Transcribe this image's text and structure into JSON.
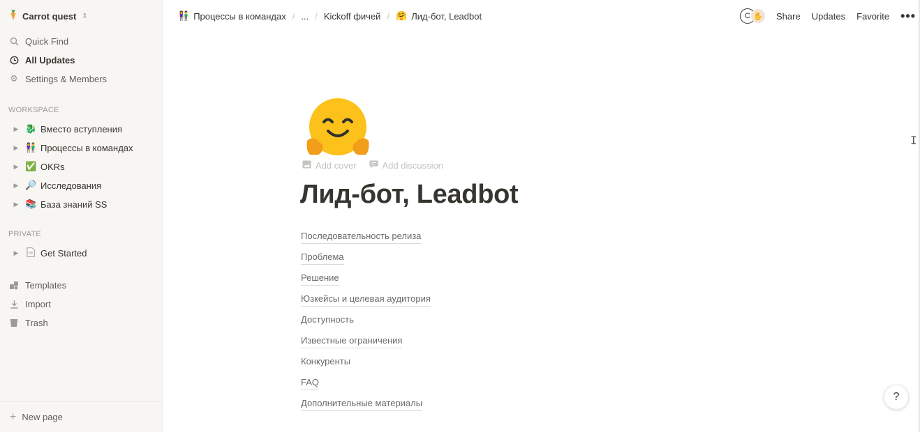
{
  "workspace": {
    "name": "Carrot quest",
    "icon": "carrot-icon"
  },
  "sidebar": {
    "top_items": [
      {
        "label": "Quick Find",
        "icon": "search-icon"
      },
      {
        "label": "All Updates",
        "icon": "clock-icon"
      },
      {
        "label": "Settings & Members",
        "icon": "gear-icon"
      }
    ],
    "workspace_label": "WORKSPACE",
    "workspace_pages": [
      {
        "emoji": "🐉",
        "label": "Вместо вступления"
      },
      {
        "emoji": "👫",
        "label": "Процессы в командах"
      },
      {
        "emoji": "✅",
        "label": "OKRs"
      },
      {
        "emoji": "🔎",
        "label": "Исследования"
      },
      {
        "emoji": "📚",
        "label": "База знаний SS"
      }
    ],
    "private_label": "PRIVATE",
    "private_pages": [
      {
        "emoji": "📄",
        "label": "Get Started"
      }
    ],
    "bottom_items": [
      {
        "label": "Templates",
        "icon": "templates-icon"
      },
      {
        "label": "Import",
        "icon": "import-icon"
      },
      {
        "label": "Trash",
        "icon": "trash-icon"
      }
    ],
    "new_page_label": "New page"
  },
  "breadcrumbs": [
    {
      "emoji": "👫",
      "label": "Процессы в командах"
    },
    {
      "emoji": "",
      "label": "..."
    },
    {
      "emoji": "",
      "label": "Kickoff фичей"
    },
    {
      "emoji": "🤗",
      "label": "Лид-бот, Leadbot"
    }
  ],
  "topbar": {
    "avatar_letter": "C",
    "share": "Share",
    "updates": "Updates",
    "favorite": "Favorite",
    "more": "•••"
  },
  "page": {
    "add_cover": "Add cover",
    "add_discussion": "Add discussion",
    "title": "Лид-бот, Leadbot",
    "toc": [
      {
        "label": "Последовательность релиза",
        "linked": true
      },
      {
        "label": "Проблема",
        "linked": true
      },
      {
        "label": "Решение",
        "linked": true
      },
      {
        "label": "Юзкейсы и целевая аудитория",
        "linked": true
      },
      {
        "label": "Доступность",
        "linked": false
      },
      {
        "label": "Известные ограничения",
        "linked": true
      },
      {
        "label": "Конкуренты",
        "linked": false
      },
      {
        "label": "FAQ",
        "linked": true
      },
      {
        "label": "Дополнительные материалы",
        "linked": true
      }
    ]
  },
  "help_label": "?"
}
